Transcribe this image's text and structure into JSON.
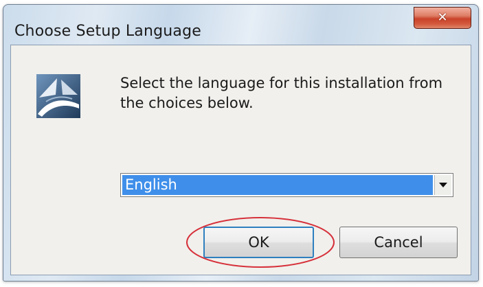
{
  "window": {
    "title": "Choose Setup Language",
    "close_icon": "close-icon",
    "close_glyph": "✕"
  },
  "dialog": {
    "logo_icon": "setup-app-logo",
    "message": "Select the language for this installation from the choices below.",
    "language_select": {
      "selected": "English",
      "icon": "chevron-down-icon"
    },
    "buttons": {
      "ok_label": "OK",
      "cancel_label": "Cancel"
    },
    "annotation": {
      "shape": "ellipse",
      "color": "#d6303a",
      "target": "ok-button"
    }
  },
  "colors": {
    "selection": "#3f8fea",
    "close_button": "#c8432a",
    "dialog_background": "#f1f0ec"
  }
}
